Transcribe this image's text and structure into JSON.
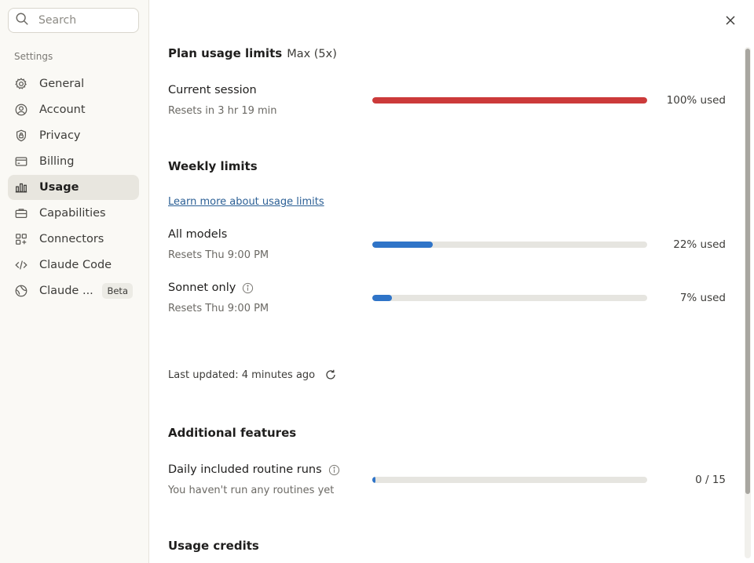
{
  "search": {
    "placeholder": "Search"
  },
  "sidebar": {
    "section_label": "Settings",
    "items": [
      {
        "label": "General",
        "icon": "gear-icon"
      },
      {
        "label": "Account",
        "icon": "user-circle-icon"
      },
      {
        "label": "Privacy",
        "icon": "shield-lock-icon"
      },
      {
        "label": "Billing",
        "icon": "credit-card-icon"
      },
      {
        "label": "Usage",
        "icon": "bar-chart-icon",
        "active": true
      },
      {
        "label": "Capabilities",
        "icon": "briefcase-icon"
      },
      {
        "label": "Connectors",
        "icon": "connectors-icon"
      },
      {
        "label": "Claude Code",
        "icon": "code-icon"
      },
      {
        "label": "Claude ...",
        "icon": "globe-icon",
        "badge": "Beta"
      }
    ]
  },
  "plan": {
    "title": "Plan usage limits",
    "tier": "Max (5x)",
    "session": {
      "title": "Current session",
      "reset": "Resets in 3 hr 19 min",
      "percent": 100,
      "label": "100% used",
      "color": "#cc3a3a"
    }
  },
  "weekly": {
    "title": "Weekly limits",
    "link": "Learn more about usage limits",
    "all_models": {
      "title": "All models",
      "reset": "Resets Thu 9:00 PM",
      "percent": 22,
      "label": "22% used",
      "color": "#2f74c8"
    },
    "sonnet": {
      "title": "Sonnet only",
      "reset": "Resets Thu 9:00 PM",
      "percent": 7,
      "label": "7% used",
      "color": "#2f74c8"
    }
  },
  "last_updated": "Last updated: 4 minutes ago",
  "additional": {
    "title": "Additional features",
    "routines": {
      "title": "Daily included routine runs",
      "sub": "You haven't run any routines yet",
      "used": 0,
      "total": 15,
      "label": "0 / 15",
      "color": "#2f74c8"
    }
  },
  "credits": {
    "title": "Usage credits"
  }
}
